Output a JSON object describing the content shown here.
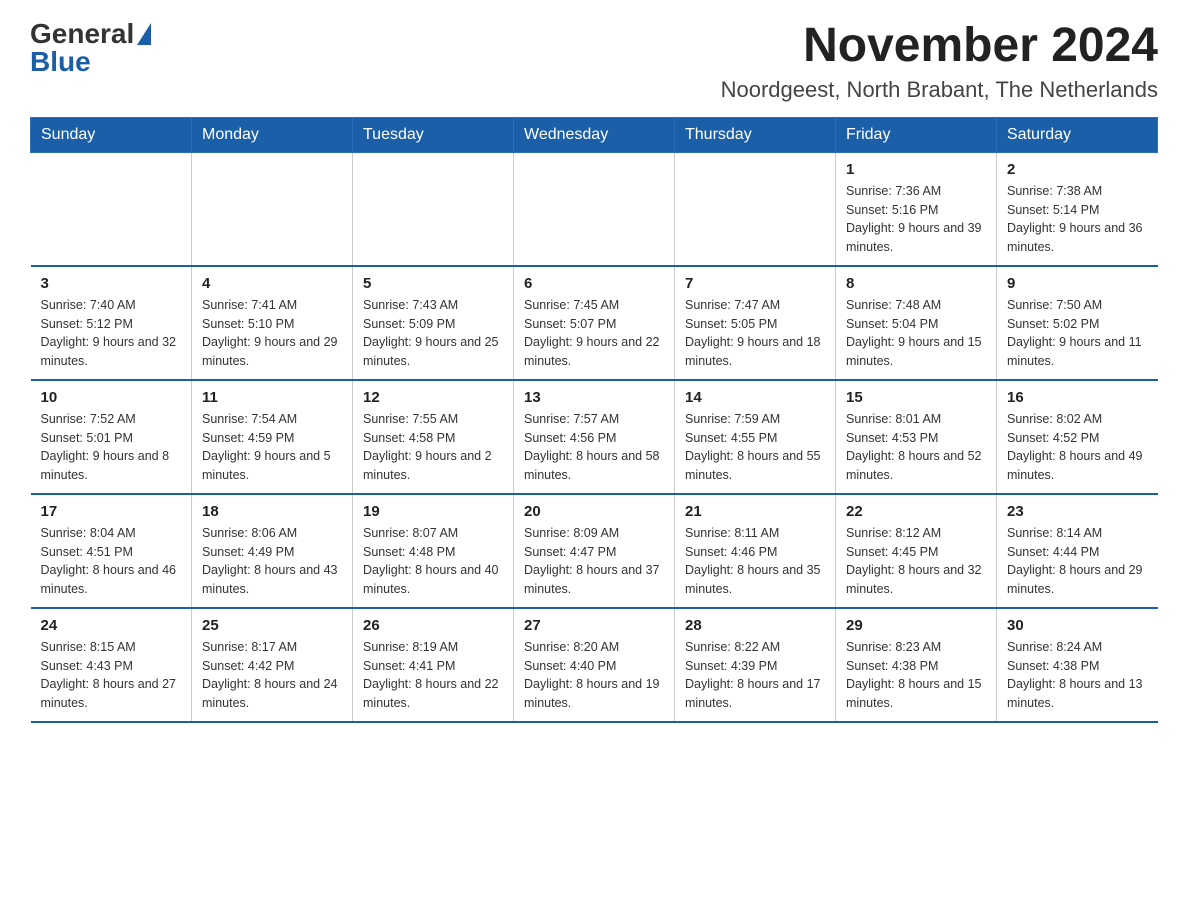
{
  "logo": {
    "general": "General",
    "blue": "Blue"
  },
  "title": "November 2024",
  "subtitle": "Noordgeest, North Brabant, The Netherlands",
  "days_of_week": [
    "Sunday",
    "Monday",
    "Tuesday",
    "Wednesday",
    "Thursday",
    "Friday",
    "Saturday"
  ],
  "weeks": [
    [
      {
        "day": "",
        "info": ""
      },
      {
        "day": "",
        "info": ""
      },
      {
        "day": "",
        "info": ""
      },
      {
        "day": "",
        "info": ""
      },
      {
        "day": "",
        "info": ""
      },
      {
        "day": "1",
        "info": "Sunrise: 7:36 AM\nSunset: 5:16 PM\nDaylight: 9 hours and 39 minutes."
      },
      {
        "day": "2",
        "info": "Sunrise: 7:38 AM\nSunset: 5:14 PM\nDaylight: 9 hours and 36 minutes."
      }
    ],
    [
      {
        "day": "3",
        "info": "Sunrise: 7:40 AM\nSunset: 5:12 PM\nDaylight: 9 hours and 32 minutes."
      },
      {
        "day": "4",
        "info": "Sunrise: 7:41 AM\nSunset: 5:10 PM\nDaylight: 9 hours and 29 minutes."
      },
      {
        "day": "5",
        "info": "Sunrise: 7:43 AM\nSunset: 5:09 PM\nDaylight: 9 hours and 25 minutes."
      },
      {
        "day": "6",
        "info": "Sunrise: 7:45 AM\nSunset: 5:07 PM\nDaylight: 9 hours and 22 minutes."
      },
      {
        "day": "7",
        "info": "Sunrise: 7:47 AM\nSunset: 5:05 PM\nDaylight: 9 hours and 18 minutes."
      },
      {
        "day": "8",
        "info": "Sunrise: 7:48 AM\nSunset: 5:04 PM\nDaylight: 9 hours and 15 minutes."
      },
      {
        "day": "9",
        "info": "Sunrise: 7:50 AM\nSunset: 5:02 PM\nDaylight: 9 hours and 11 minutes."
      }
    ],
    [
      {
        "day": "10",
        "info": "Sunrise: 7:52 AM\nSunset: 5:01 PM\nDaylight: 9 hours and 8 minutes."
      },
      {
        "day": "11",
        "info": "Sunrise: 7:54 AM\nSunset: 4:59 PM\nDaylight: 9 hours and 5 minutes."
      },
      {
        "day": "12",
        "info": "Sunrise: 7:55 AM\nSunset: 4:58 PM\nDaylight: 9 hours and 2 minutes."
      },
      {
        "day": "13",
        "info": "Sunrise: 7:57 AM\nSunset: 4:56 PM\nDaylight: 8 hours and 58 minutes."
      },
      {
        "day": "14",
        "info": "Sunrise: 7:59 AM\nSunset: 4:55 PM\nDaylight: 8 hours and 55 minutes."
      },
      {
        "day": "15",
        "info": "Sunrise: 8:01 AM\nSunset: 4:53 PM\nDaylight: 8 hours and 52 minutes."
      },
      {
        "day": "16",
        "info": "Sunrise: 8:02 AM\nSunset: 4:52 PM\nDaylight: 8 hours and 49 minutes."
      }
    ],
    [
      {
        "day": "17",
        "info": "Sunrise: 8:04 AM\nSunset: 4:51 PM\nDaylight: 8 hours and 46 minutes."
      },
      {
        "day": "18",
        "info": "Sunrise: 8:06 AM\nSunset: 4:49 PM\nDaylight: 8 hours and 43 minutes."
      },
      {
        "day": "19",
        "info": "Sunrise: 8:07 AM\nSunset: 4:48 PM\nDaylight: 8 hours and 40 minutes."
      },
      {
        "day": "20",
        "info": "Sunrise: 8:09 AM\nSunset: 4:47 PM\nDaylight: 8 hours and 37 minutes."
      },
      {
        "day": "21",
        "info": "Sunrise: 8:11 AM\nSunset: 4:46 PM\nDaylight: 8 hours and 35 minutes."
      },
      {
        "day": "22",
        "info": "Sunrise: 8:12 AM\nSunset: 4:45 PM\nDaylight: 8 hours and 32 minutes."
      },
      {
        "day": "23",
        "info": "Sunrise: 8:14 AM\nSunset: 4:44 PM\nDaylight: 8 hours and 29 minutes."
      }
    ],
    [
      {
        "day": "24",
        "info": "Sunrise: 8:15 AM\nSunset: 4:43 PM\nDaylight: 8 hours and 27 minutes."
      },
      {
        "day": "25",
        "info": "Sunrise: 8:17 AM\nSunset: 4:42 PM\nDaylight: 8 hours and 24 minutes."
      },
      {
        "day": "26",
        "info": "Sunrise: 8:19 AM\nSunset: 4:41 PM\nDaylight: 8 hours and 22 minutes."
      },
      {
        "day": "27",
        "info": "Sunrise: 8:20 AM\nSunset: 4:40 PM\nDaylight: 8 hours and 19 minutes."
      },
      {
        "day": "28",
        "info": "Sunrise: 8:22 AM\nSunset: 4:39 PM\nDaylight: 8 hours and 17 minutes."
      },
      {
        "day": "29",
        "info": "Sunrise: 8:23 AM\nSunset: 4:38 PM\nDaylight: 8 hours and 15 minutes."
      },
      {
        "day": "30",
        "info": "Sunrise: 8:24 AM\nSunset: 4:38 PM\nDaylight: 8 hours and 13 minutes."
      }
    ]
  ]
}
